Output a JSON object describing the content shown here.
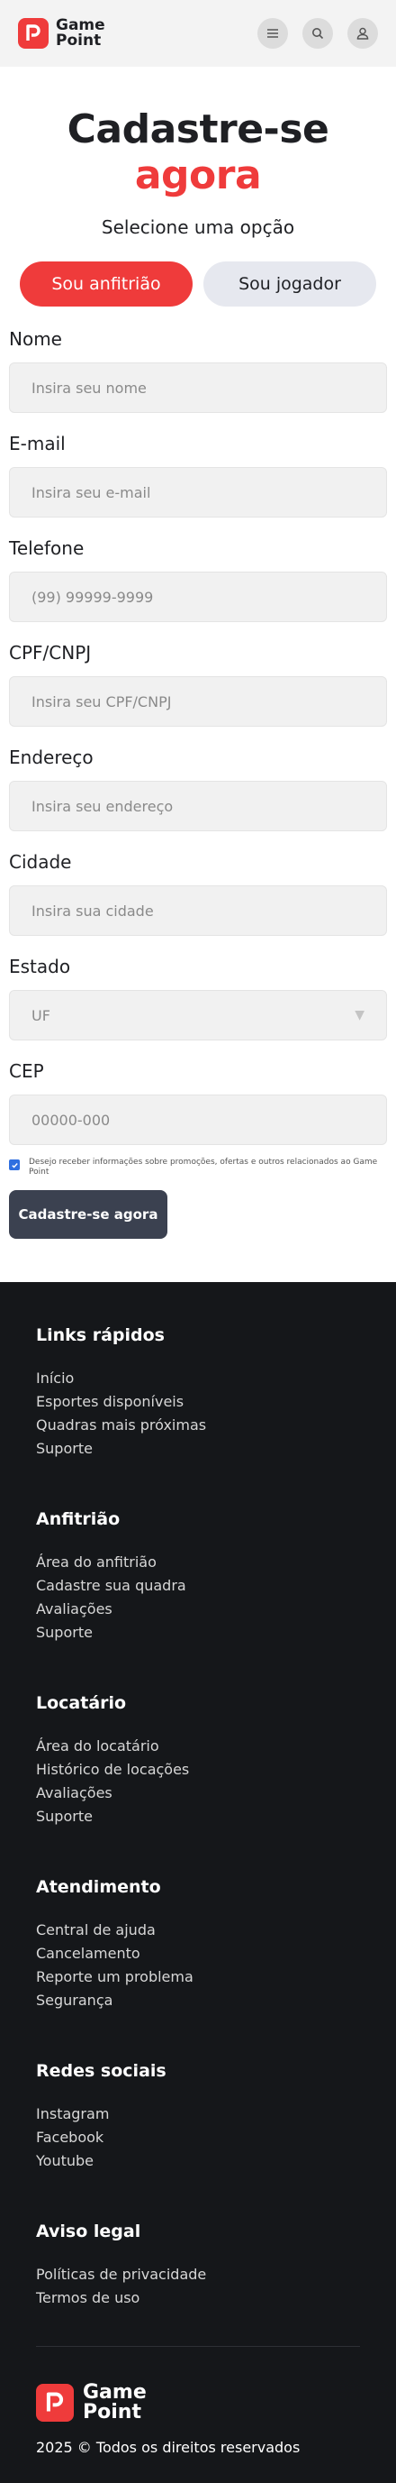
{
  "header": {
    "logo_line1": "Game",
    "logo_line2": "Point",
    "icons": [
      "menu-icon",
      "search-icon",
      "user-icon"
    ]
  },
  "hero": {
    "title_main": "Cadastre-se",
    "title_accent": "agora",
    "subtitle": "Selecione uma opção",
    "options": [
      "Sou anfitrião",
      "Sou jogador"
    ],
    "selected_option": "Sou anfitrião"
  },
  "form": {
    "fields": [
      {
        "label": "Nome",
        "placeholder": "Insira seu nome"
      },
      {
        "label": "E-mail",
        "placeholder": "Insira seu e-mail"
      },
      {
        "label": "Telefone",
        "placeholder": "(99) 99999-9999"
      },
      {
        "label": "CPF/CNPJ",
        "placeholder": "Insira seu CPF/CNPJ"
      },
      {
        "label": "Endereço",
        "placeholder": "Insira seu endereço"
      },
      {
        "label": "Cidade",
        "placeholder": "Insira sua cidade"
      },
      {
        "label": "Estado",
        "placeholder": "UF"
      },
      {
        "label": "CEP",
        "placeholder": "00000-000"
      }
    ],
    "consent_text": "Desejo receber informações sobre promoções, ofertas e outros relacionados ao Game Point",
    "consent_checked": true,
    "submit_label": "Cadastre-se agora"
  },
  "footer": {
    "sections": [
      {
        "title": "Links rápidos",
        "links": [
          "Início",
          "Esportes disponíveis",
          "Quadras mais próximas",
          "Suporte"
        ]
      },
      {
        "title": "Anfitrião",
        "links": [
          "Área do anfitrião",
          "Cadastre sua quadra",
          "Avaliações",
          "Suporte"
        ]
      },
      {
        "title": "Locatário",
        "links": [
          "Área do locatário",
          "Histórico de locações",
          "Avaliações",
          "Suporte"
        ]
      },
      {
        "title": "Atendimento",
        "links": [
          "Central de ajuda",
          "Cancelamento",
          "Reporte um problema",
          "Segurança"
        ]
      },
      {
        "title": "Redes sociais",
        "links": [
          "Instagram",
          "Facebook",
          "Youtube"
        ]
      },
      {
        "title": "Aviso legal",
        "links": [
          "Políticas de privacidade",
          "Termos de uso"
        ]
      }
    ],
    "copyright": "2025 © Todos os direitos reservados"
  },
  "colors": {
    "brand": "#ef3b3b",
    "footer_bg": "#15171a",
    "button_dark": "#3b4150"
  }
}
